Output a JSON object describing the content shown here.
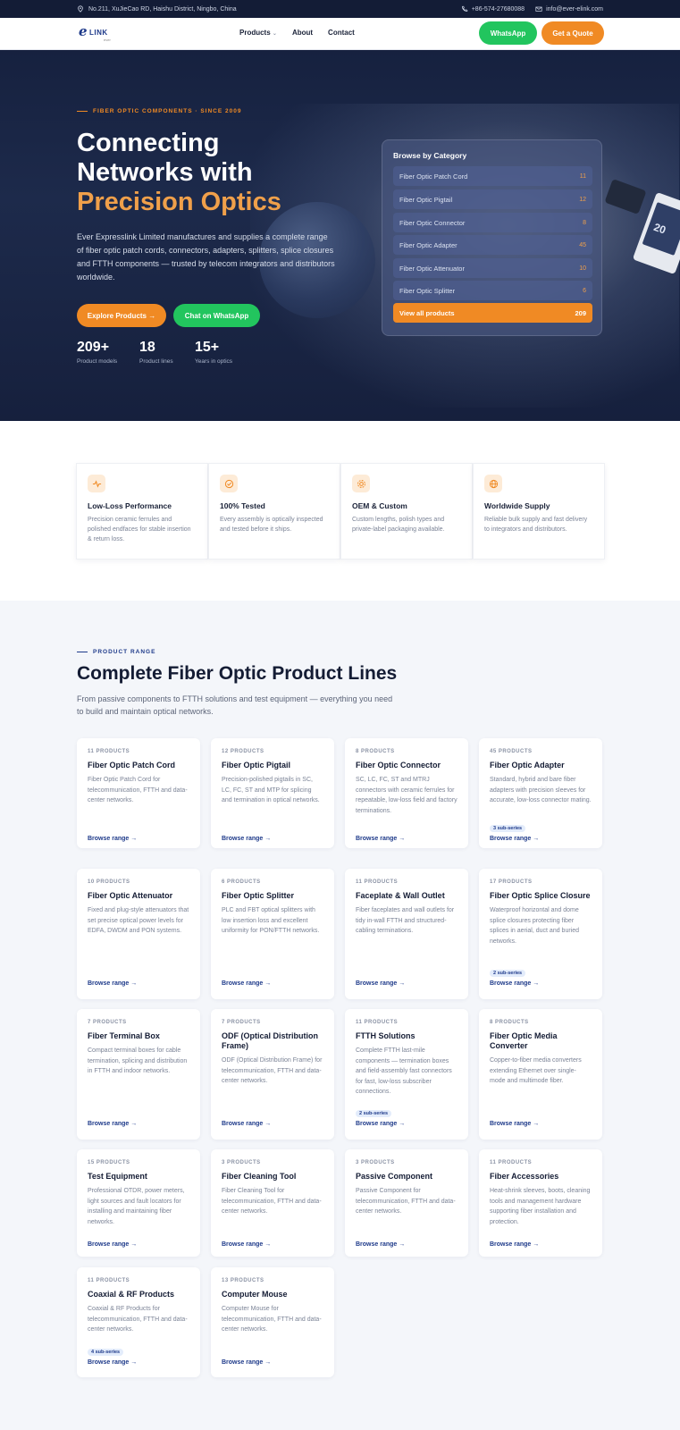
{
  "topbar": {
    "address": "No.211, XuJieCao RD, Haishu District, Ningbo, China",
    "phone": "+86-574-27680088",
    "email": "info@ever-elink.com"
  },
  "nav": {
    "logo_mark": "e",
    "logo_text": "LINK",
    "logo_sub": "ever",
    "items": [
      "Products",
      "About",
      "Contact"
    ],
    "whatsapp": "WhatsApp",
    "quote": "Get a Quote"
  },
  "hero": {
    "eyebrow": "FIBER OPTIC COMPONENTS · SINCE 2009",
    "title_line1": "Connecting",
    "title_line2": "Networks with",
    "title_accent": "Precision Optics",
    "lead": "Ever Expresslink Limited manufactures and supplies a complete range of fiber optic patch cords, connectors, adapters, splitters, splice closures and FTTH components — trusted by telecom integrators and distributors worldwide.",
    "btn_explore": "Explore Products →",
    "btn_chat": "Chat on WhatsApp",
    "stats": [
      {
        "num": "209+",
        "label": "Product models"
      },
      {
        "num": "18",
        "label": "Product lines"
      },
      {
        "num": "15+",
        "label": "Years in optics"
      }
    ],
    "gadget_text": "20"
  },
  "categories": {
    "heading": "Browse by Category",
    "items": [
      {
        "name": "Fiber Optic Patch Cord",
        "count": "11"
      },
      {
        "name": "Fiber Optic Pigtail",
        "count": "12"
      },
      {
        "name": "Fiber Optic Connector",
        "count": "8"
      },
      {
        "name": "Fiber Optic Adapter",
        "count": "45"
      },
      {
        "name": "Fiber Optic Attenuator",
        "count": "10"
      },
      {
        "name": "Fiber Optic Splitter",
        "count": "6"
      }
    ],
    "view_all": "View all products",
    "view_all_count": "209"
  },
  "features": [
    {
      "icon": "pulse-icon",
      "title": "Low-Loss Performance",
      "desc": "Precision ceramic ferrules and polished endfaces for stable insertion & return loss."
    },
    {
      "icon": "check-circle-icon",
      "title": "100% Tested",
      "desc": "Every assembly is optically inspected and tested before it ships."
    },
    {
      "icon": "gear-icon",
      "title": "OEM & Custom",
      "desc": "Custom lengths, polish types and private-label packaging available."
    },
    {
      "icon": "globe-icon",
      "title": "Worldwide Supply",
      "desc": "Reliable bulk supply and fast delivery to integrators and distributors."
    }
  ],
  "products": {
    "eyebrow": "PRODUCT RANGE",
    "title": "Complete Fiber Optic Product Lines",
    "subtitle": "From passive components to FTTH solutions and test equipment — everything you need to build and maintain optical networks.",
    "browse_label": "Browse range →",
    "cards": [
      {
        "count": "11 PRODUCTS",
        "name": "Fiber Optic Patch Cord",
        "desc": "Fiber Optic Patch Cord for telecommunication, FTTH and data-center networks.",
        "sub": ""
      },
      {
        "count": "12 PRODUCTS",
        "name": "Fiber Optic Pigtail",
        "desc": "Precision-polished pigtails in SC, LC, FC, ST and MTP for splicing and termination in optical networks.",
        "sub": ""
      },
      {
        "count": "8 PRODUCTS",
        "name": "Fiber Optic Connector",
        "desc": "SC, LC, FC, ST and MTRJ connectors with ceramic ferrules for repeatable, low-loss field and factory terminations.",
        "sub": ""
      },
      {
        "count": "45 PRODUCTS",
        "name": "Fiber Optic Adapter",
        "desc": "Standard, hybrid and bare fiber adapters with precision sleeves for accurate, low-loss connector mating.",
        "sub": "3 sub-series"
      },
      {
        "count": "10 PRODUCTS",
        "name": "Fiber Optic Attenuator",
        "desc": "Fixed and plug-style attenuators that set precise optical power levels for EDFA, DWDM and PON systems.",
        "sub": ""
      },
      {
        "count": "6 PRODUCTS",
        "name": "Fiber Optic Splitter",
        "desc": "PLC and FBT optical splitters with low insertion loss and excellent uniformity for PON/FTTH networks.",
        "sub": ""
      },
      {
        "count": "11 PRODUCTS",
        "name": "Faceplate & Wall Outlet",
        "desc": "Fiber faceplates and wall outlets for tidy in-wall FTTH and structured-cabling terminations.",
        "sub": ""
      },
      {
        "count": "17 PRODUCTS",
        "name": "Fiber Optic Splice Closure",
        "desc": "Waterproof horizontal and dome splice closures protecting fiber splices in aerial, duct and buried networks.",
        "sub": "2 sub-series"
      },
      {
        "count": "7 PRODUCTS",
        "name": "Fiber Terminal Box",
        "desc": "Compact terminal boxes for cable termination, splicing and distribution in FTTH and indoor networks.",
        "sub": ""
      },
      {
        "count": "7 PRODUCTS",
        "name": "ODF (Optical Distribution Frame)",
        "desc": "ODF (Optical Distribution Frame) for telecommunication, FTTH and data-center networks.",
        "sub": ""
      },
      {
        "count": "11 PRODUCTS",
        "name": "FTTH Solutions",
        "desc": "Complete FTTH last-mile components — termination boxes and field-assembly fast connectors for fast, low-loss subscriber connections.",
        "sub": "2 sub-series"
      },
      {
        "count": "8 PRODUCTS",
        "name": "Fiber Optic Media Converter",
        "desc": "Copper-to-fiber media converters extending Ethernet over single-mode and multimode fiber.",
        "sub": ""
      },
      {
        "count": "15 PRODUCTS",
        "name": "Test Equipment",
        "desc": "Professional OTDR, power meters, light sources and fault locators for installing and maintaining fiber networks.",
        "sub": ""
      },
      {
        "count": "3 PRODUCTS",
        "name": "Fiber Cleaning Tool",
        "desc": "Fiber Cleaning Tool for telecommunication, FTTH and data-center networks.",
        "sub": ""
      },
      {
        "count": "3 PRODUCTS",
        "name": "Passive Component",
        "desc": "Passive Component for telecommunication, FTTH and data-center networks.",
        "sub": ""
      },
      {
        "count": "11 PRODUCTS",
        "name": "Fiber Accessories",
        "desc": "Heat-shrink sleeves, boots, cleaning tools and management hardware supporting fiber installation and protection.",
        "sub": ""
      },
      {
        "count": "11 PRODUCTS",
        "name": "Coaxial & RF Products",
        "desc": "Coaxial & RF Products for telecommunication, FTTH and data-center networks.",
        "sub": "4 sub-series"
      },
      {
        "count": "13 PRODUCTS",
        "name": "Computer Mouse",
        "desc": "Computer Mouse for telecommunication, FTTH and data-center networks.",
        "sub": ""
      }
    ]
  }
}
